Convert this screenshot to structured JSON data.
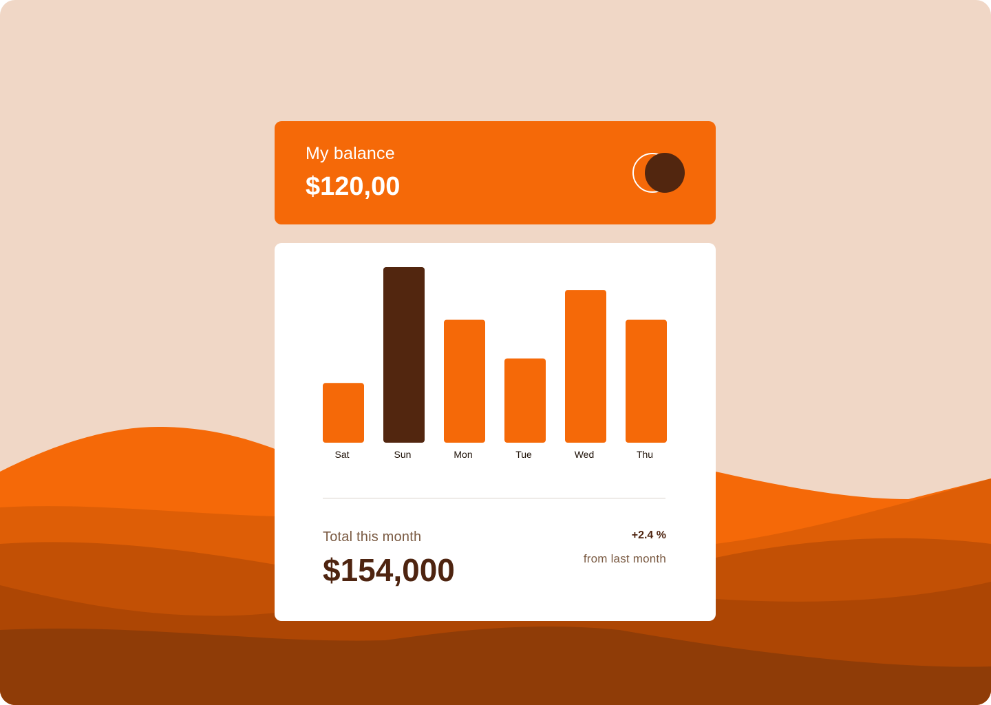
{
  "balance": {
    "label": "My balance",
    "amount": "$120,00"
  },
  "chart_data": {
    "type": "bar",
    "categories": [
      "Sat",
      "Sun",
      "Mon",
      "Tue",
      "Wed",
      "Thu"
    ],
    "values": [
      34,
      100,
      70,
      48,
      87,
      70
    ],
    "highlight": "Sun"
  },
  "summary": {
    "total_label": "Total this month",
    "total_amount": "$154,000",
    "change_value": "+2.4 %",
    "change_caption": "from last month"
  },
  "colors": {
    "background": "#F0D7C6",
    "accent": "#F56908",
    "highlight": "#52260F",
    "text_dark": "#4E2410",
    "text_muted": "#7A5A42"
  }
}
